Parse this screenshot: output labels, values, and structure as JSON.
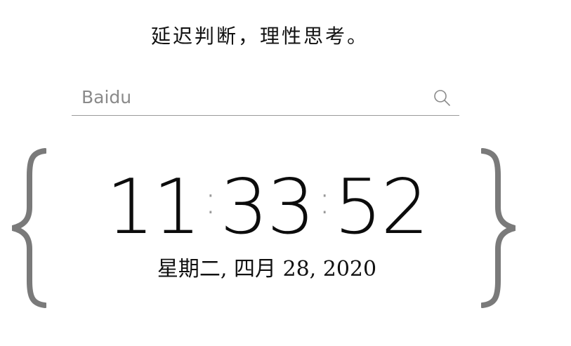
{
  "motto": "延迟判断，理性思考。",
  "search": {
    "placeholder": "Baidu",
    "value": "",
    "icon": "search-icon"
  },
  "clock": {
    "hours": "11",
    "minutes": "33",
    "seconds": "52",
    "separator": ":"
  },
  "date": "星期二, 四月 28, 2020",
  "colors": {
    "text": "#111111",
    "brace": "#7a7a7a",
    "separator": "#9a9a9a",
    "underline": "#9a9a9a"
  }
}
